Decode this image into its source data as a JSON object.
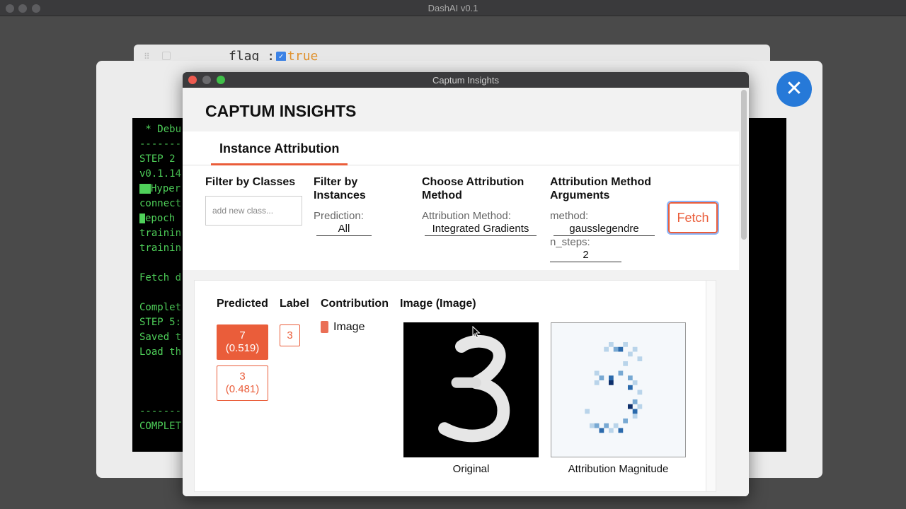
{
  "outer_window": {
    "title": "DashAI v0.1",
    "back_card_code": [
      "flag",
      ":",
      "true"
    ],
    "terminal_lines": [
      " * Debu",
      "-------",
      "STEP 2",
      "v0.1.14",
      "Hyper",
      "connect",
      "epoch",
      "trainin",
      "trainin",
      "",
      "Fetch d",
      "",
      "Complet",
      "STEP 5:",
      "Saved t",
      "Load th",
      "",
      "",
      "",
      "-------",
      "COMPLET"
    ]
  },
  "captum": {
    "window_title": "Captum Insights",
    "heading": "CAPTUM INSIGHTS",
    "tab_label": "Instance Attribution",
    "filters": {
      "classes_heading": "Filter by Classes",
      "classes_placeholder": "add new class...",
      "instances_heading": "Filter by Instances",
      "prediction_label": "Prediction:",
      "prediction_value": "All",
      "method_heading": "Choose Attribution Method",
      "method_label": "Attribution Method:",
      "method_value": "Integrated Gradients",
      "args_heading": "Attribution Method Arguments",
      "args_method_label": "method:",
      "args_method_value": "gausslegendre",
      "args_nsteps_label": "n_steps:",
      "args_nsteps_value": "2",
      "fetch_label": "Fetch"
    },
    "results": {
      "col_predicted": "Predicted",
      "col_label": "Label",
      "col_contribution": "Contribution",
      "col_image": "Image (Image)",
      "predictions": [
        {
          "label": "7",
          "score": "(0.519)"
        },
        {
          "label": "3",
          "score": "(0.481)"
        }
      ],
      "true_label": "3",
      "contribution_name": "Image",
      "original_caption": "Original",
      "attribution_caption": "Attribution Magnitude"
    }
  },
  "colors": {
    "accent": "#ea5d3a",
    "close_button": "#2679d8",
    "terminal_text": "#4fd15a"
  },
  "icons": {
    "close": "close-icon",
    "cursor": "mouse-cursor-icon"
  }
}
